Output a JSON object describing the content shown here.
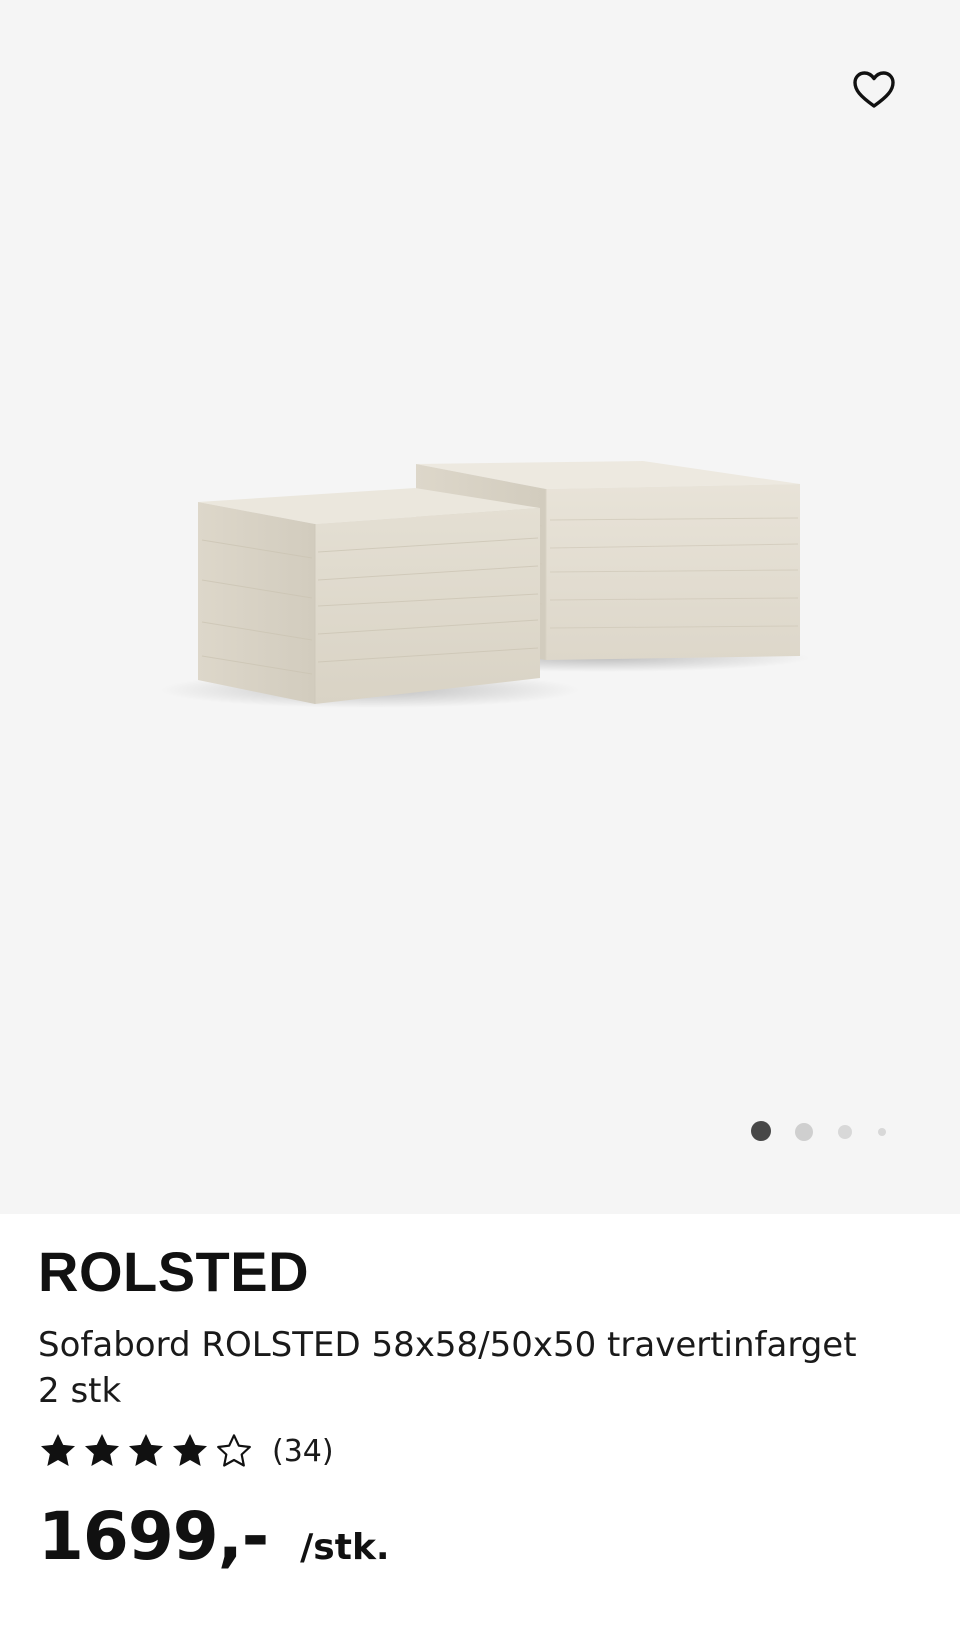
{
  "gallery": {
    "favorite_icon": "heart-outline-icon",
    "image_alt": "Sofabord ROLSTED 58x58/50x50 travertinfarget 2 stk",
    "current_slide": 1,
    "total_slides": 4,
    "background_color": "#f5f5f5",
    "active_dot_color": "#484848",
    "inactive_dot_color": "#cfcfcf"
  },
  "product": {
    "name": "ROLSTED",
    "description_line1": "Sofabord ROLSTED 58x58/50x50 travertinfarget",
    "description_line2": "2 stk",
    "rating": 4,
    "rating_max": 5,
    "review_count": "(34)",
    "price": "1699,-",
    "unit": "/stk."
  }
}
